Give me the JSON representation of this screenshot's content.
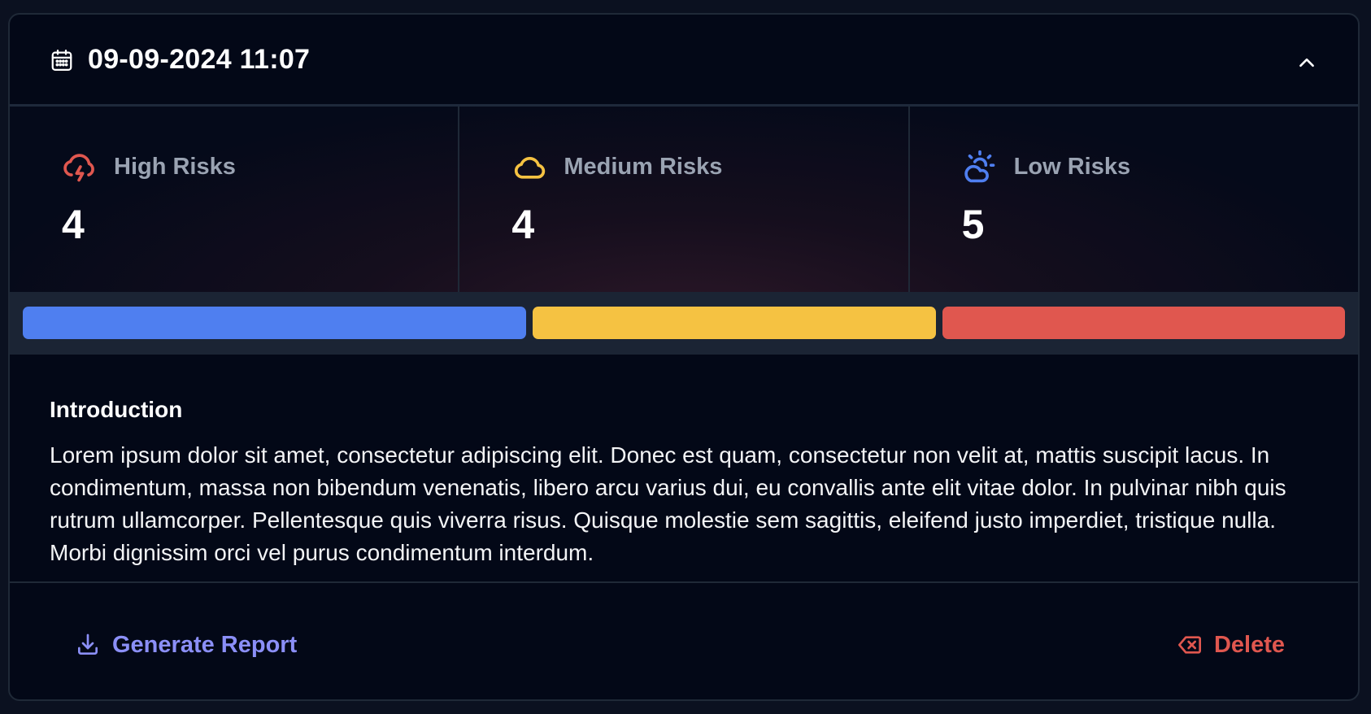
{
  "header": {
    "datetime": "09-09-2024 11:07",
    "calendar_icon": "calendar-icon",
    "collapse_icon": "chevron-up-icon"
  },
  "stats": [
    {
      "label": "High Risks",
      "value": "4",
      "icon": "cloud-lightning-icon",
      "color": "#e0574f"
    },
    {
      "label": "Medium Risks",
      "value": "4",
      "icon": "cloud-icon",
      "color": "#f5c242"
    },
    {
      "label": "Low Risks",
      "value": "5",
      "icon": "cloud-sun-icon",
      "color": "#4f7ff0"
    }
  ],
  "risk_bar": {
    "segments": [
      {
        "name": "low",
        "count": 5,
        "color": "#4f7ff0"
      },
      {
        "name": "medium",
        "count": 4,
        "color": "#f5c242"
      },
      {
        "name": "high",
        "count": 4,
        "color": "#e0574f"
      }
    ]
  },
  "intro": {
    "title": "Introduction",
    "body": "Lorem ipsum dolor sit amet, consectetur adipiscing elit. Donec est quam, consectetur non velit at, mattis suscipit lacus. In condimentum, massa non bibendum venenatis, libero arcu varius dui, eu convallis ante elit vitae dolor. In pulvinar nibh quis rutrum ullamcorper. Pellentesque quis viverra risus. Quisque molestie sem sagittis, eleifend justo imperdiet, tristique nulla. Morbi dignissim orci vel purus condimentum interdum."
  },
  "actions": {
    "generate_report": "Generate Report",
    "generate_report_icon": "download-icon",
    "delete": "Delete",
    "delete_icon": "backspace-icon"
  },
  "colors": {
    "background": "#030817",
    "accent_link": "#8b8ff7",
    "danger": "#e0574f"
  }
}
